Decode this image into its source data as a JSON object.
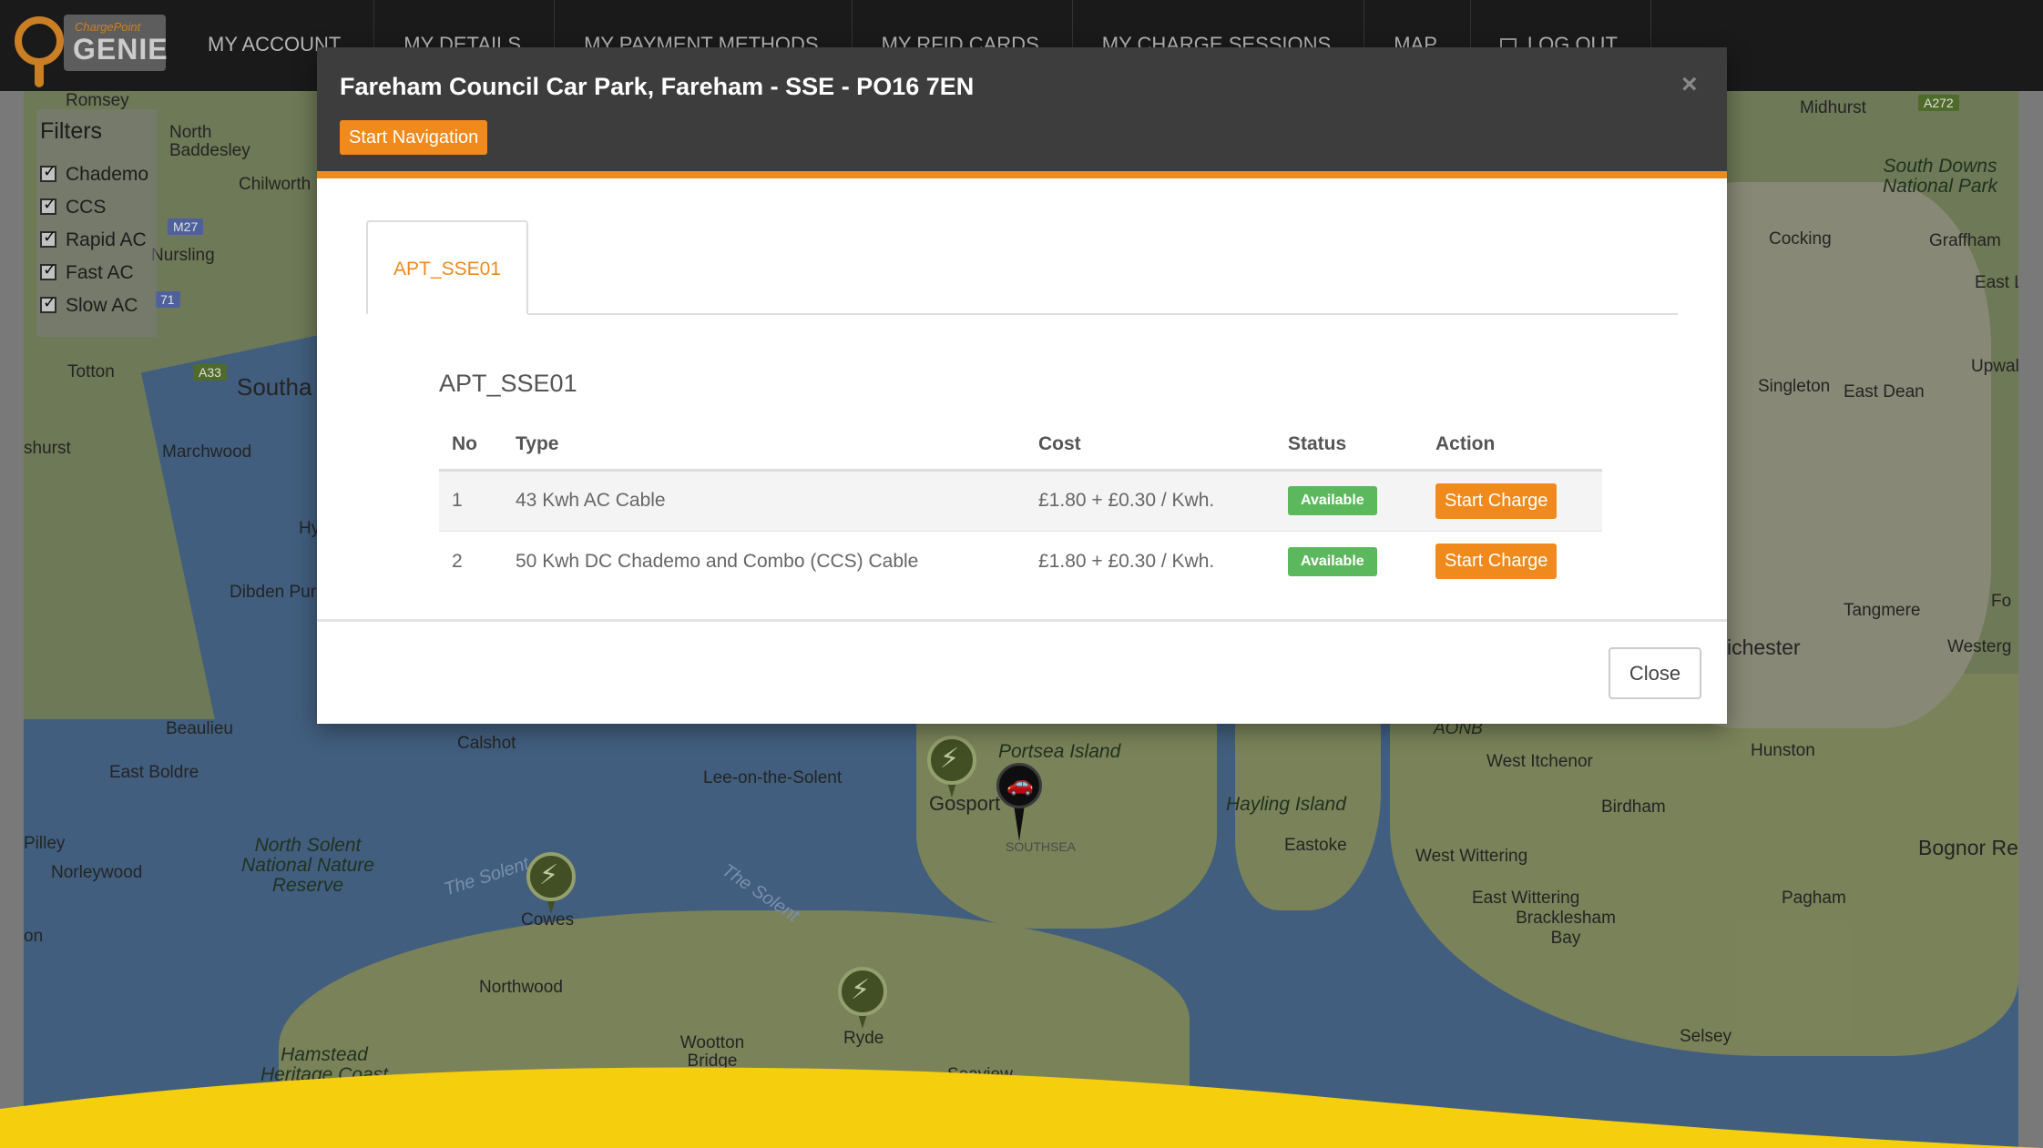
{
  "brand": {
    "small": "ChargePoint",
    "name": "GENIE",
    "accent": "#ef8a1e"
  },
  "nav": {
    "items": [
      {
        "label": "MY ACCOUNT"
      },
      {
        "label": "MY DETAILS"
      },
      {
        "label": "MY PAYMENT METHODS"
      },
      {
        "label": "MY RFID CARDS"
      },
      {
        "label": "MY CHARGE SESSIONS"
      },
      {
        "label": "MAP"
      },
      {
        "label": "LOG OUT",
        "icon": "logout-icon"
      }
    ]
  },
  "filters": {
    "title": "Filters",
    "options": [
      {
        "label": "Chademo",
        "checked": true
      },
      {
        "label": "CCS",
        "checked": true
      },
      {
        "label": "Rapid AC",
        "checked": true
      },
      {
        "label": "Fast AC",
        "checked": true
      },
      {
        "label": "Slow AC",
        "checked": true
      }
    ]
  },
  "map": {
    "labels": {
      "romsey": "Romsey",
      "north_baddesley": "North Baddesley",
      "chilworth": "Chilworth",
      "nursling": "Nursling",
      "totton": "Totton",
      "southampton": "Southa",
      "marchwood": "Marchwood",
      "hythe": "Hy",
      "dibden": "Dibden Pur",
      "ashurst": "shurst",
      "beaulieu": "Beaulieu",
      "calshot": "Calshot",
      "east_boldre": "East Boldre",
      "pilley": "Pilley",
      "norleywood": "Norleywood",
      "nsnr": "North Solent National Nature Reserve",
      "lee": "Lee-on-the-Solent",
      "portsea": "Portsea Island",
      "gosport": "Gosport",
      "southsea": "SOUTHSEA",
      "hayling": "Hayling Island",
      "eastoke": "Eastoke",
      "west_itchenor": "West Itchenor",
      "hunston": "Hunston",
      "birdham": "Birdham",
      "west_wittering": "West Wittering",
      "east_wittering": "East Wittering",
      "bracklesham": "Bracklesham Bay",
      "bognor": "Bognor Re",
      "pagham": "Pagham",
      "selsey": "Selsey",
      "cowes": "Cowes",
      "the_solent_1": "The Solent",
      "the_solent_2": "The Solent",
      "northwood": "Northwood",
      "wootton": "Wootton Bridge",
      "ryde": "Ryde",
      "seaview": "Seaview",
      "hamstead": "Hamstead Heritage Coast",
      "midhurst": "Midhurst",
      "south_downs": "South Downs National Park",
      "cocking": "Cocking",
      "graffham": "Graffham",
      "east_l": "East L",
      "upwal": "Upwal",
      "singleton": "Singleton",
      "east_dean": "East Dean",
      "tangmere": "Tangmere",
      "chichester": "ichester",
      "westerg": "Westerg",
      "fo": "Fo",
      "aonb": "AONB",
      "on": "on"
    },
    "roads": {
      "m27": "M27",
      "a33": "A33",
      "m271": "71",
      "a272": "A272"
    }
  },
  "modal": {
    "title": "Fareham Council Car Park, Fareham - SSE - PO16 7EN",
    "navigation_label": "Start Navigation",
    "tab_label": "APT_SSE01",
    "section_title": "APT_SSE01",
    "columns": [
      "No",
      "Type",
      "Cost",
      "Status",
      "Action"
    ],
    "rows": [
      {
        "no": "1",
        "type": "43 Kwh AC Cable",
        "cost": "£1.80 + £0.30 / Kwh.",
        "status": "Available",
        "action": "Start Charge"
      },
      {
        "no": "2",
        "type": "50 Kwh DC Chademo and Combo (CCS) Cable",
        "cost": "£1.80 + £0.30 / Kwh.",
        "status": "Available",
        "action": "Start Charge"
      }
    ],
    "close_label": "Close",
    "close_x": "×"
  }
}
